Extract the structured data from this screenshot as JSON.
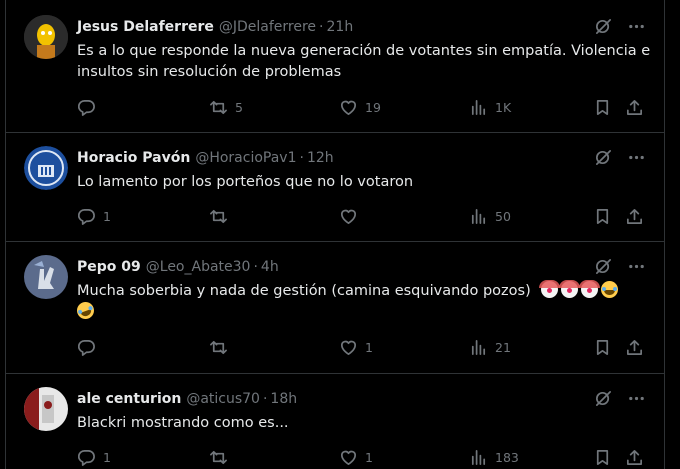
{
  "posts": [
    {
      "name": "Jesus Delaferrere",
      "handle": "@JDelaferrere",
      "time": "21h",
      "text": "Es a lo que responde la nueva generación de votantes sin empatía. Violencia e insultos sin resolución de problemas",
      "replies": "",
      "reposts": "5",
      "likes": "19",
      "views": "1K"
    },
    {
      "name": "Horacio Pavón",
      "handle": "@HoracioPav1",
      "time": "12h",
      "text": "Lo lamento por los porteños que no lo votaron",
      "replies": "1",
      "reposts": "",
      "likes": "",
      "views": "50"
    },
    {
      "name": "Pepo 09",
      "handle": "@Leo_Abate30",
      "time": "4h",
      "text": "Mucha soberbia y nada de gestión (camina esquivando pozos)",
      "replies": "",
      "reposts": "",
      "likes": "1",
      "views": "21"
    },
    {
      "name": "ale centurion",
      "handle": "@aticus70",
      "time": "18h",
      "text": "Blackri mostrando como es...",
      "replies": "1",
      "reposts": "",
      "likes": "1",
      "views": "183"
    }
  ],
  "separator": "·",
  "icons": {
    "grok": "grok-icon",
    "more": "more-icon",
    "reply": "reply-icon",
    "repost": "repost-icon",
    "like": "like-icon",
    "views": "views-icon",
    "bookmark": "bookmark-icon",
    "share": "share-icon"
  },
  "colors": {
    "background": "#000000",
    "text": "#e7e9ea",
    "secondary": "#71767b",
    "border": "#2f3336"
  }
}
